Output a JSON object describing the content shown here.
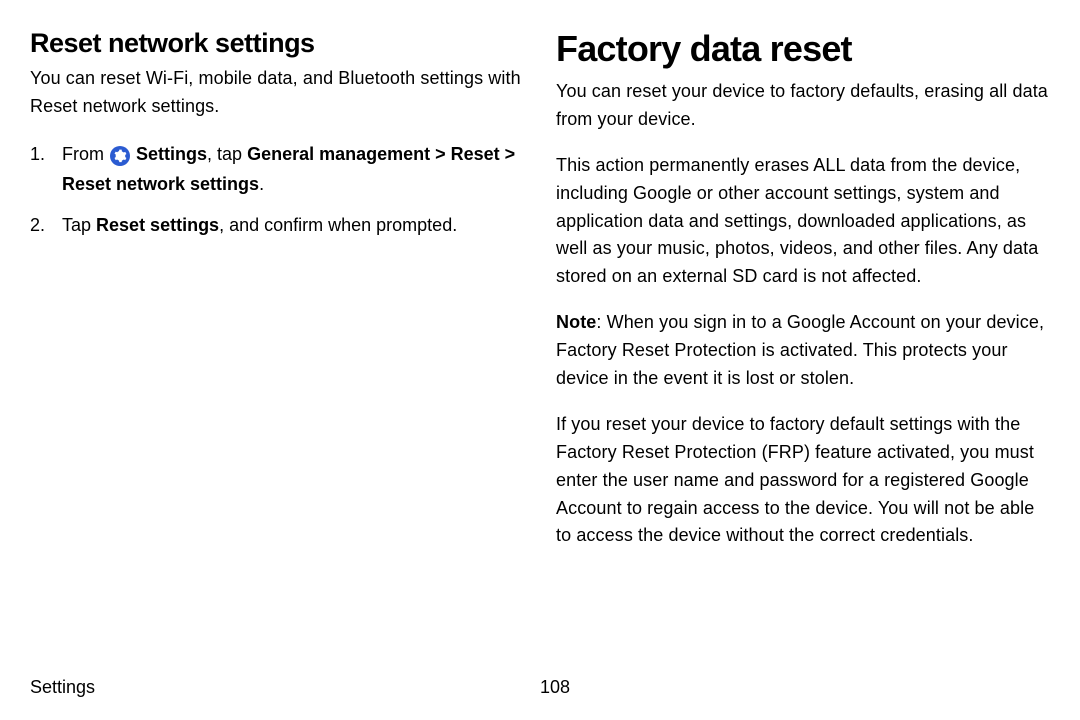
{
  "left": {
    "heading": "Reset network settings",
    "intro": "You can reset Wi-Fi, mobile data, and Bluetooth settings with Reset network settings.",
    "step1_pre": "From ",
    "step1_settings": "Settings",
    "step1_mid": ", tap ",
    "step1_path": "General management > Reset > Reset network settings",
    "step1_post": ".",
    "step2_pre": "Tap ",
    "step2_bold": "Reset settings",
    "step2_post": ", and confirm when prompted."
  },
  "right": {
    "heading": "Factory data reset",
    "p1": "You can reset your device to factory defaults, erasing all data from your device.",
    "p2": "This action permanently erases ALL data from the device, including Google or other account settings, system and application data and settings, downloaded applications, as well as your music, photos, videos, and other files. Any data stored on an external SD card is not affected.",
    "note_label": "Note",
    "p3_rest": ": When you sign in to a Google Account on your device, Factory Reset Protection is activated. This protects your device in the event it is lost or stolen.",
    "p4": "If you reset your device to factory default settings with the Factory Reset Protection (FRP) feature activated, you must enter the user name and password for a registered Google Account to regain access to the device. You will not be able to access the device without the correct credentials."
  },
  "footer": {
    "section": "Settings",
    "page": "108"
  }
}
